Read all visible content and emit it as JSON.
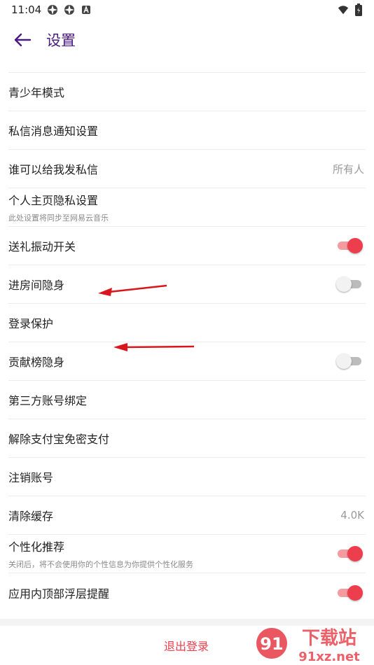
{
  "status_bar": {
    "time": "11:04"
  },
  "header": {
    "title": "设置"
  },
  "rows": [
    {
      "label": "青少年模式"
    },
    {
      "label": "私信消息通知设置"
    },
    {
      "label": "谁可以给我发私信",
      "value": "所有人"
    },
    {
      "label": "个人主页隐私设置",
      "sub": "此处设置将同步至网易云音乐"
    },
    {
      "label": "送礼振动开关",
      "toggle": "on"
    },
    {
      "label": "进房间隐身",
      "toggle": "off"
    },
    {
      "label": "登录保护"
    },
    {
      "label": "贡献榜隐身",
      "toggle": "off"
    },
    {
      "label": "第三方账号绑定"
    },
    {
      "label": "解除支付宝免密支付"
    },
    {
      "label": "注销账号"
    },
    {
      "label": "清除缓存",
      "value": "4.0K"
    },
    {
      "label": "个性化推荐",
      "sub": "关闭后，将不会使用你的个性信息为你提供个性化服务",
      "toggle": "on"
    },
    {
      "label": "应用内顶部浮层提醒",
      "toggle": "on"
    }
  ],
  "logout": {
    "label": "退出登录"
  },
  "watermark": {
    "line1": "下载站",
    "line2": "91xz.net"
  },
  "colors": {
    "accent": "#ec3e4c",
    "title": "#4a1a80",
    "annotation": "#d9161c"
  }
}
